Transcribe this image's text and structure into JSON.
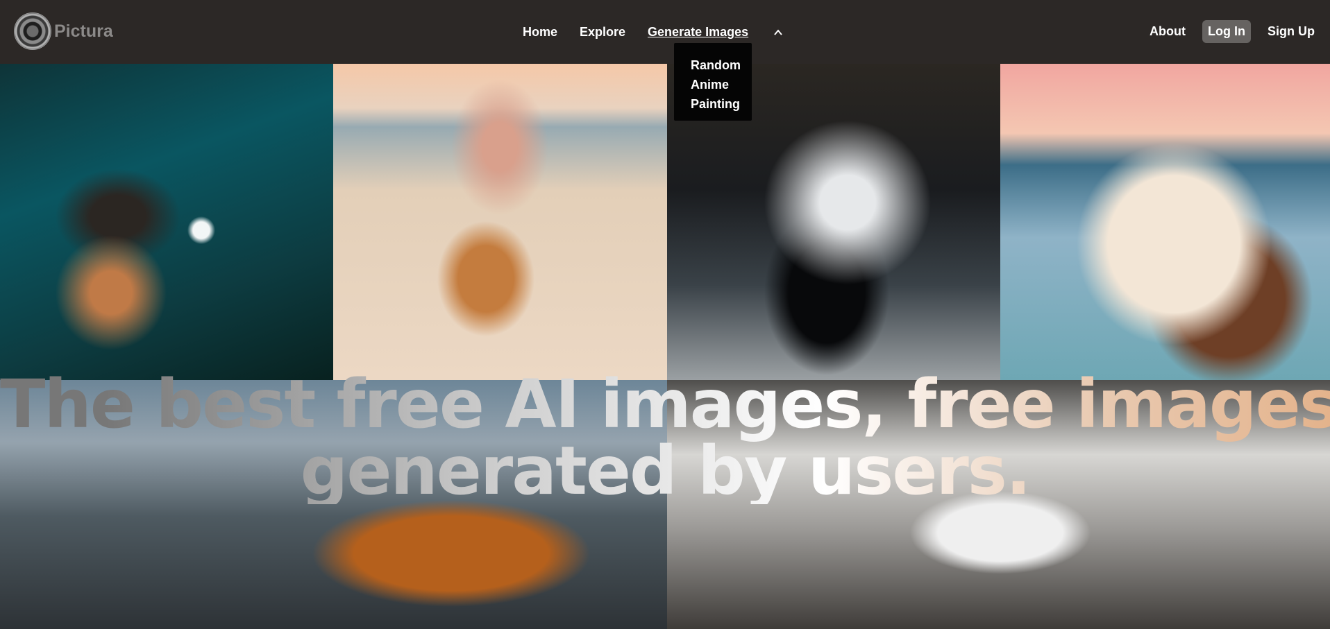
{
  "brand": {
    "name": "Pictura",
    "logo_icon": "camera-lens-icon"
  },
  "nav": {
    "home": "Home",
    "explore": "Explore",
    "generate": "Generate Images",
    "generate_icon": "chevron-up-icon",
    "about": "About",
    "login": "Log In",
    "signup": "Sign Up"
  },
  "dropdown": {
    "items": [
      "Random",
      "Anime",
      "Painting"
    ]
  },
  "hero": {
    "line1": "The best free AI images, free images",
    "line2": "generated by users."
  },
  "colors": {
    "topbar": "#2c2826",
    "dropdown": "#050505",
    "login_bg": "#666361"
  }
}
